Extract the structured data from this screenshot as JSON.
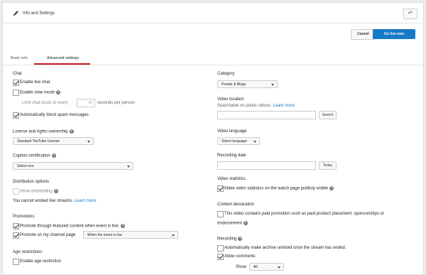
{
  "header": {
    "title": "Info and Settings",
    "back_glyph": "↶"
  },
  "actions": {
    "cancel": "Cancel",
    "go_live": "Go live now"
  },
  "tabs": [
    "Basic info",
    "Advanced settings"
  ],
  "left": {
    "chat": {
      "title": "Chat",
      "enable_live_chat": "Enable live chat",
      "enable_slow_mode": "Enable slow mode",
      "limit_prefix": "Limit chat posts to every",
      "limit_value": "60",
      "limit_suffix": "seconds per person",
      "block_spam": "Automatically block spam messages"
    },
    "license": {
      "title": "License and rights ownership",
      "value": "Standard YouTube License"
    },
    "caption": {
      "title": "Caption certification",
      "value": "Select one"
    },
    "distribution": {
      "title": "Distribution options",
      "allow_embedding": "Allow embedding",
      "note": "You cannot embed live streams.",
      "learn_more": "Learn more"
    },
    "promotions": {
      "title": "Promotions",
      "featured": "Promote through featured content when event is live.",
      "channel_page": "Promote on my channel page",
      "channel_select": "When the event is live"
    },
    "age": {
      "title": "Age restrictions",
      "enable": "Enable age restriction"
    }
  },
  "right": {
    "category": {
      "title": "Category",
      "value": "People & Blogs"
    },
    "location": {
      "title": "Video location",
      "hint": "Searchable on public videos.",
      "learn_more": "Learn more",
      "search": "Search"
    },
    "language": {
      "title": "Video language",
      "value": "Select language"
    },
    "recording_date": {
      "title": "Recording date",
      "today": "Today"
    },
    "statistics": {
      "title": "Video statistics",
      "public": "Make video statistics on the watch page publicly visible"
    },
    "content": {
      "title": "Content declaration",
      "line1": "This video contains paid promotion such as paid product placement, sponsorships or",
      "line2": "endorsement"
    },
    "recording": {
      "title": "Recording",
      "unlisted": "Automatically make archive unlisted once the stream has ended.",
      "allow_comments": "Allow comments",
      "show_label": "Show",
      "show_value": "All"
    }
  },
  "colors": {
    "accent": "#167ac6",
    "tab_underline": "#cc181e"
  },
  "icons": {
    "pencil": "pencil-icon",
    "back": "undo-icon",
    "help": "help-icon"
  }
}
